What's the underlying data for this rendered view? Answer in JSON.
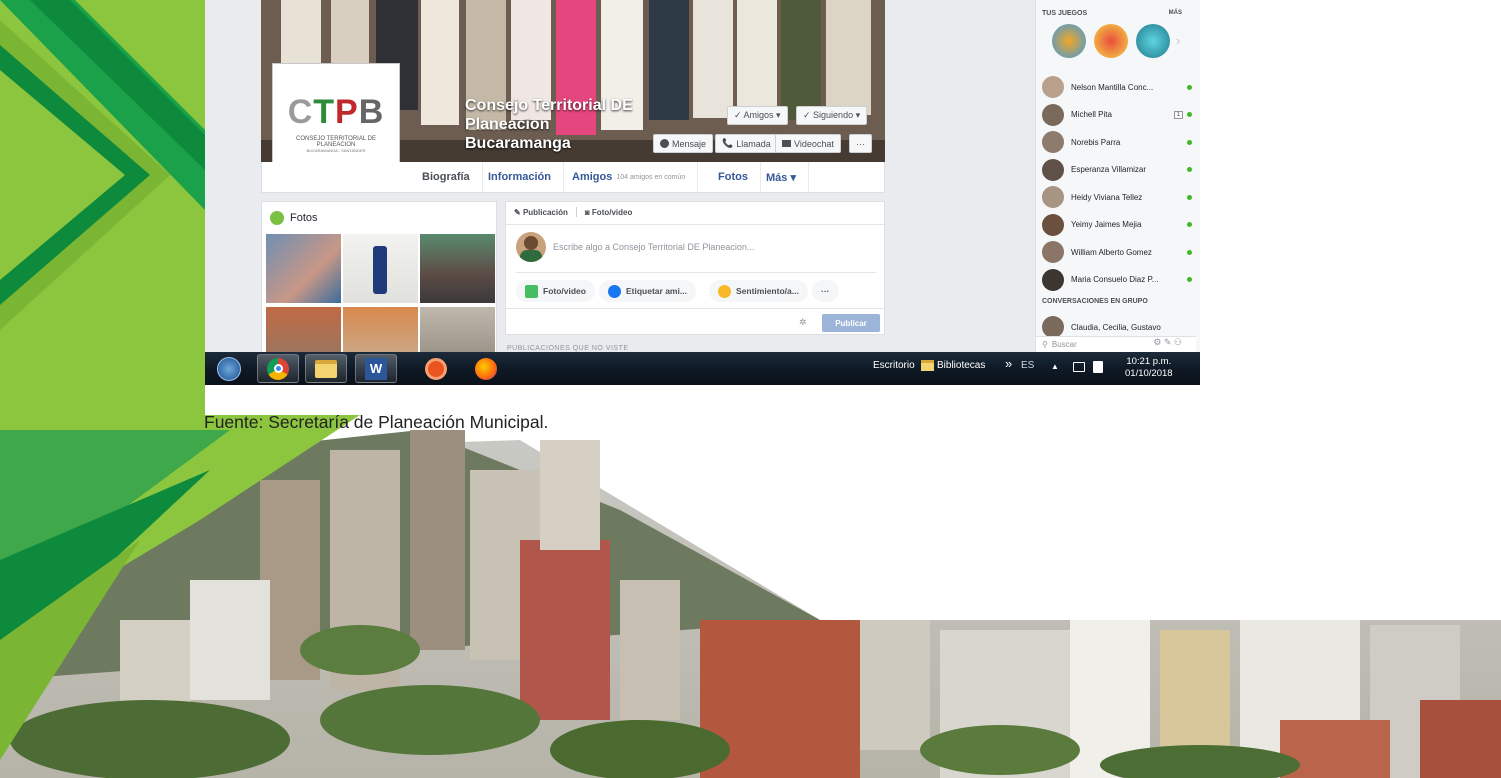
{
  "page": {
    "caption": "Fuente: Secretaría de Planeación Municipal."
  },
  "profile": {
    "logo_text": [
      "C",
      "T",
      "P",
      "B"
    ],
    "logo_sub": "CONSEJO TERRITORIAL DE PLANEACION",
    "logo_sub2": "BUCARAMANGA - SANTANDER",
    "name_lines": [
      "Consejo Territorial DE",
      "Planeacion",
      "Bucaramanga"
    ]
  },
  "cover_buttons": {
    "amigos": "✓ Amigos ▾",
    "siguiendo": "✓ Siguiendo ▾",
    "mensaje": "Mensaje",
    "llamada": "Llamada",
    "videochat": "Videochat",
    "more": "···"
  },
  "tabs": {
    "biografia": "Biografía",
    "informacion": "Información",
    "amigos": "Amigos",
    "amigos_sub": "104 amigos en común",
    "fotos": "Fotos",
    "mas": "Más ▾"
  },
  "photos": {
    "title": "Fotos"
  },
  "composer": {
    "tab_publicacion": "Publicación",
    "tab_foto": "Foto/video",
    "placeholder": "Escribe algo a Consejo Territorial DE Planeacion...",
    "chip_foto": "Foto/video",
    "chip_etiquetar": "Etiquetar ami...",
    "chip_sentimiento": "Sentimiento/a...",
    "chip_more": "···",
    "publish": "Publicar",
    "next_section": "PUBLICACIONES QUE NO VISTE"
  },
  "chat": {
    "games_title": "TUS JUEGOS",
    "games_more": "MÁS",
    "contacts": [
      {
        "name": "Nelson Mantilla Conc...",
        "color": "#b8a08c"
      },
      {
        "name": "Michell Pita",
        "badge": "1",
        "color": "#7a6a5c"
      },
      {
        "name": "Norebis Parra",
        "color": "#8d7b6d"
      },
      {
        "name": "Esperanza Villamizar",
        "color": "#5f5147"
      },
      {
        "name": "Heidy Viviana Tellez",
        "color": "#a79483"
      },
      {
        "name": "Yeimy Jaimes Mejia",
        "color": "#6b4f3f"
      },
      {
        "name": "William Alberto Gomez",
        "color": "#8a7566"
      },
      {
        "name": "Maria Consuelo Diaz P...",
        "color": "#3c3530"
      }
    ],
    "group_title": "CONVERSACIONES EN GRUPO",
    "group_name": "Claudia, Cecilia, Gustavo",
    "search": "Buscar"
  },
  "taskbar": {
    "escritorio": "Escritorio",
    "bibliotecas": "Bibliotecas",
    "chevrons": "»",
    "lang": "ES",
    "time": "10:21 p.m.",
    "date": "01/10/2018"
  },
  "colors": {
    "fb_blue": "#365899",
    "green_dark": "#1a8a3a",
    "green_light": "#8cc63f",
    "online": "#42b72a"
  }
}
